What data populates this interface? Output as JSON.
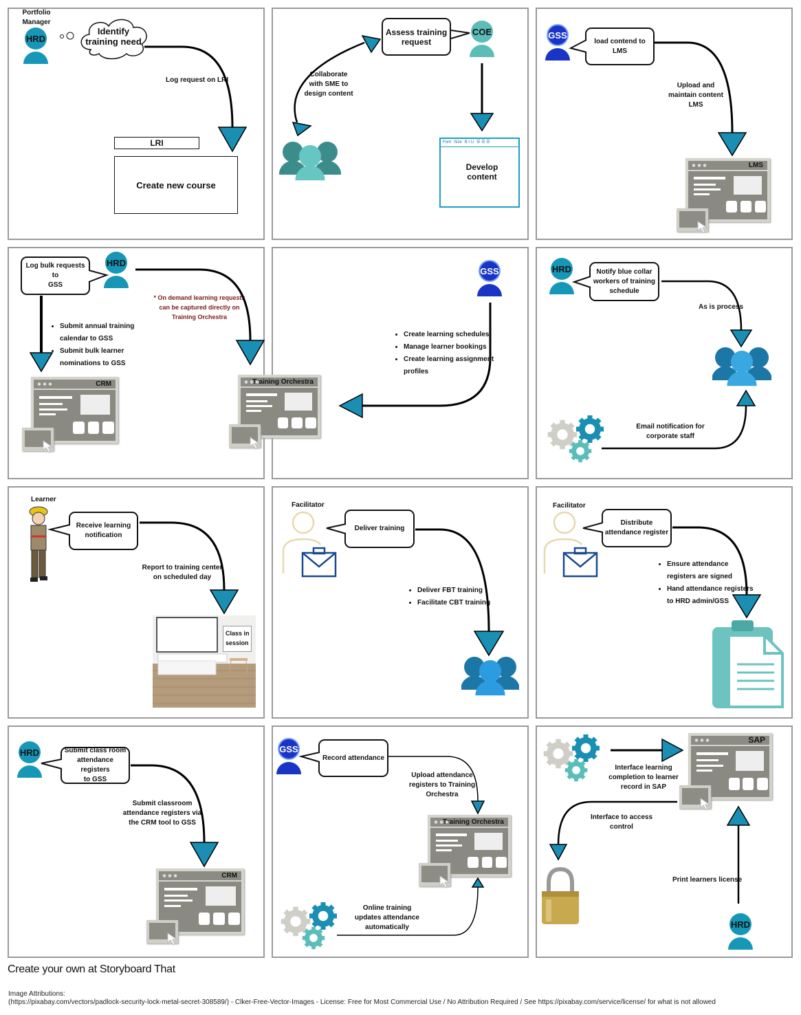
{
  "colors": {
    "hrd": "#1797b8",
    "gss": "#1a35c6",
    "coe": "#5cbcb8",
    "arrow_head": "#1a8fb3",
    "note_red": "#7a1a1a",
    "team_dark": "#3d8c8c",
    "team_light": "#66c6c2"
  },
  "p1": {
    "role": "Portfolio\nManager",
    "person": "HRD",
    "thought": "Identify\ntraining need",
    "arrow_label": "Log request on LRI",
    "lri": "LRI",
    "action": "Create new course"
  },
  "p2": {
    "bubble": "Assess training\nrequest",
    "person": "COE",
    "collab": "Collaborate\nwith SME to\ndesign content",
    "editor_font": "Font",
    "editor_size": "Size",
    "editor_fmt": "B I U",
    "action": "Develop\ncontent"
  },
  "p3": {
    "person": "GSS",
    "bubble": "load contend to LMS",
    "label": "Upload and\nmaintain content\nLMS",
    "window": "LMS"
  },
  "p4": {
    "bubble": "Log bulk  requests to\nGSS",
    "person": "HRD",
    "note": "* On demand learning requests\ncan be captured directly on\nTraining Orchestra",
    "bullets": [
      "Submit annual training\ncalendar to GSS",
      "Submit bulk learner\nnominations to GSS"
    ],
    "window_left": "CRM",
    "window_right": "Training Orchestra"
  },
  "p5": {
    "person": "GSS",
    "bullets": [
      "Create learning schedules",
      "Manage learner bookings",
      "Create learning assignment\nprofiles"
    ]
  },
  "p6": {
    "person": "HRD",
    "bubble": "Notify blue collar\nworkers of training\nschedule",
    "as_is": "As is process",
    "email": "Email notification for\ncorporate staff"
  },
  "p7": {
    "role": "Learner",
    "bubble": "Receive learning\nnotification",
    "label": "Report to training center\non scheduled day",
    "sign": "Class in\nsession"
  },
  "p8": {
    "role": "Facilitator",
    "bubble": "Deliver training",
    "bullets": [
      "Deliver FBT training",
      "Facilitate CBT training"
    ]
  },
  "p9": {
    "role": "Facilitator",
    "bubble": "Distribute\nattendance register",
    "bullets": [
      "Ensure attendance\nregisters are signed",
      "Hand attendance registers\nto HRD admin/GSS"
    ]
  },
  "p10": {
    "person": "HRD",
    "bubble": "Submit class room\nattendance registers\nto GSS",
    "label": "Submit classroom\nattendance registers via\nthe CRM tool to GSS",
    "window": "CRM"
  },
  "p11": {
    "person": "GSS",
    "bubble": "Record attendance",
    "upload": "Upload attendance\nregisters to Training\nOrchestra",
    "window": "Training Orchestra",
    "online": "Online training\nupdates attendance\nautomatically"
  },
  "p12": {
    "window": "SAP",
    "interface_sap": "Interface learning\ncompletion to learner\nrecord in SAP",
    "interface_access": "Interface to access\ncontrol",
    "print": "Print learners license",
    "person": "HRD"
  },
  "footer": {
    "promo": "Create your own at Storyboard That",
    "attribution": "Image Attributions:\n(https://pixabay.com/vectors/padlock-security-lock-metal-secret-308589/) - Clker-Free-Vector-Images - License: Free for Most Commercial Use / No Attribution Required / See https://pixabay.com/service/license/ for what is not allowed"
  }
}
